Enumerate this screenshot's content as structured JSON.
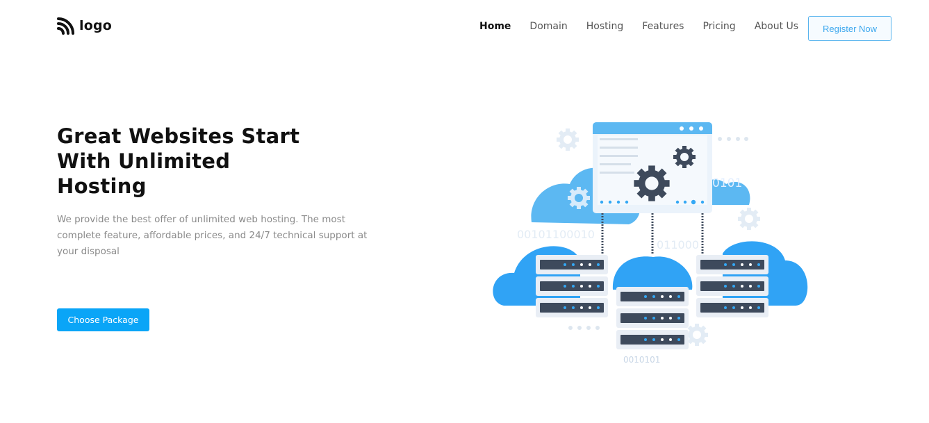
{
  "brand": {
    "logo_text": "logo"
  },
  "nav": {
    "items": [
      {
        "label": "Home",
        "active": true
      },
      {
        "label": "Domain"
      },
      {
        "label": "Hosting"
      },
      {
        "label": "Features"
      },
      {
        "label": "Pricing"
      },
      {
        "label": "About Us"
      }
    ],
    "register_label": "Register Now"
  },
  "hero": {
    "title_lines": [
      "Great Websites Start",
      "With Unlimited",
      "Hosting"
    ],
    "description": "We provide the best offer of unlimited web hosting. The most complete feature, affordable prices, and 24/7 technical support at your disposal",
    "cta_label": "Choose Package"
  },
  "illustration": {
    "binary_texts": [
      "0101",
      "00101100010",
      "011000",
      "0010101"
    ]
  },
  "colors": {
    "accent": "#0aa5f7",
    "cloud_light": "#5cb8f2",
    "cloud_dark": "#30a3f5",
    "server_dark": "#3e4a5c"
  }
}
